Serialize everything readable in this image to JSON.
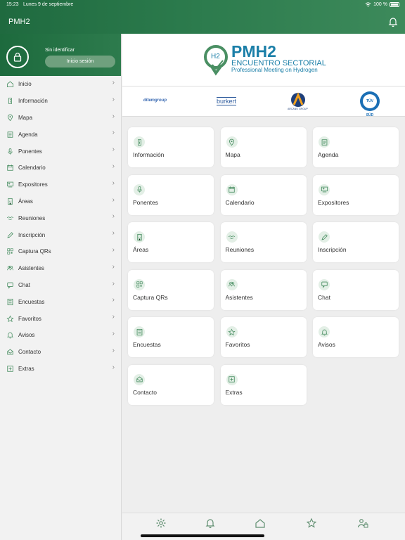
{
  "status": {
    "time": "15:23",
    "date": "Lunes 9 de septiembre",
    "battery": "100 %"
  },
  "app": {
    "title": "PMH2"
  },
  "user": {
    "status": "Sin identificar",
    "login_label": "Inicio sesión"
  },
  "menu": [
    {
      "label": "Inicio",
      "icon": "home-icon"
    },
    {
      "label": "Información",
      "icon": "info-icon"
    },
    {
      "label": "Mapa",
      "icon": "map-pin-icon"
    },
    {
      "label": "Agenda",
      "icon": "agenda-icon"
    },
    {
      "label": "Ponentes",
      "icon": "microphone-icon"
    },
    {
      "label": "Calendario",
      "icon": "calendar-icon"
    },
    {
      "label": "Expositores",
      "icon": "exhibitor-icon"
    },
    {
      "label": "Áreas",
      "icon": "building-icon"
    },
    {
      "label": "Reuniones",
      "icon": "handshake-icon"
    },
    {
      "label": "Inscripción",
      "icon": "pencil-icon"
    },
    {
      "label": "Captura QRs",
      "icon": "qr-icon"
    },
    {
      "label": "Asistentes",
      "icon": "people-icon"
    },
    {
      "label": "Chat",
      "icon": "chat-icon"
    },
    {
      "label": "Encuestas",
      "icon": "survey-icon"
    },
    {
      "label": "Favoritos",
      "icon": "star-icon"
    },
    {
      "label": "Avisos",
      "icon": "bell-icon"
    },
    {
      "label": "Contacto",
      "icon": "envelope-icon"
    },
    {
      "label": "Extras",
      "icon": "plus-square-icon"
    }
  ],
  "logo": {
    "title": "PMH2",
    "line1": "ENCUENTRO SECTORIAL",
    "line2": "Professional Meeting on Hydrogen",
    "badge": "H2"
  },
  "sponsors": [
    "ditemgroup",
    "burkert",
    "ARCANO GROUP",
    "TÜV SÜD"
  ],
  "tiles": [
    {
      "label": "Información",
      "icon": "info-icon"
    },
    {
      "label": "Mapa",
      "icon": "map-pin-icon"
    },
    {
      "label": "Agenda",
      "icon": "agenda-icon"
    },
    {
      "label": "Ponentes",
      "icon": "microphone-icon"
    },
    {
      "label": "Calendario",
      "icon": "calendar-icon"
    },
    {
      "label": "Expositores",
      "icon": "exhibitor-icon"
    },
    {
      "label": "Áreas",
      "icon": "building-icon"
    },
    {
      "label": "Reuniones",
      "icon": "handshake-icon"
    },
    {
      "label": "Inscripción",
      "icon": "pencil-icon"
    },
    {
      "label": "Captura QRs",
      "icon": "qr-icon"
    },
    {
      "label": "Asistentes",
      "icon": "people-icon"
    },
    {
      "label": "Chat",
      "icon": "chat-icon"
    },
    {
      "label": "Encuestas",
      "icon": "survey-icon"
    },
    {
      "label": "Favoritos",
      "icon": "star-icon"
    },
    {
      "label": "Avisos",
      "icon": "bell-icon"
    },
    {
      "label": "Contacto",
      "icon": "envelope-icon"
    },
    {
      "label": "Extras",
      "icon": "plus-square-icon"
    }
  ],
  "bottom_bar": [
    "gear-icon",
    "bell-icon",
    "home-icon",
    "star-icon",
    "user-lock-icon"
  ],
  "colors": {
    "brand_green": "#2b7a4c",
    "accent": "#4a8f63",
    "logo_blue": "#1b7fa8"
  }
}
